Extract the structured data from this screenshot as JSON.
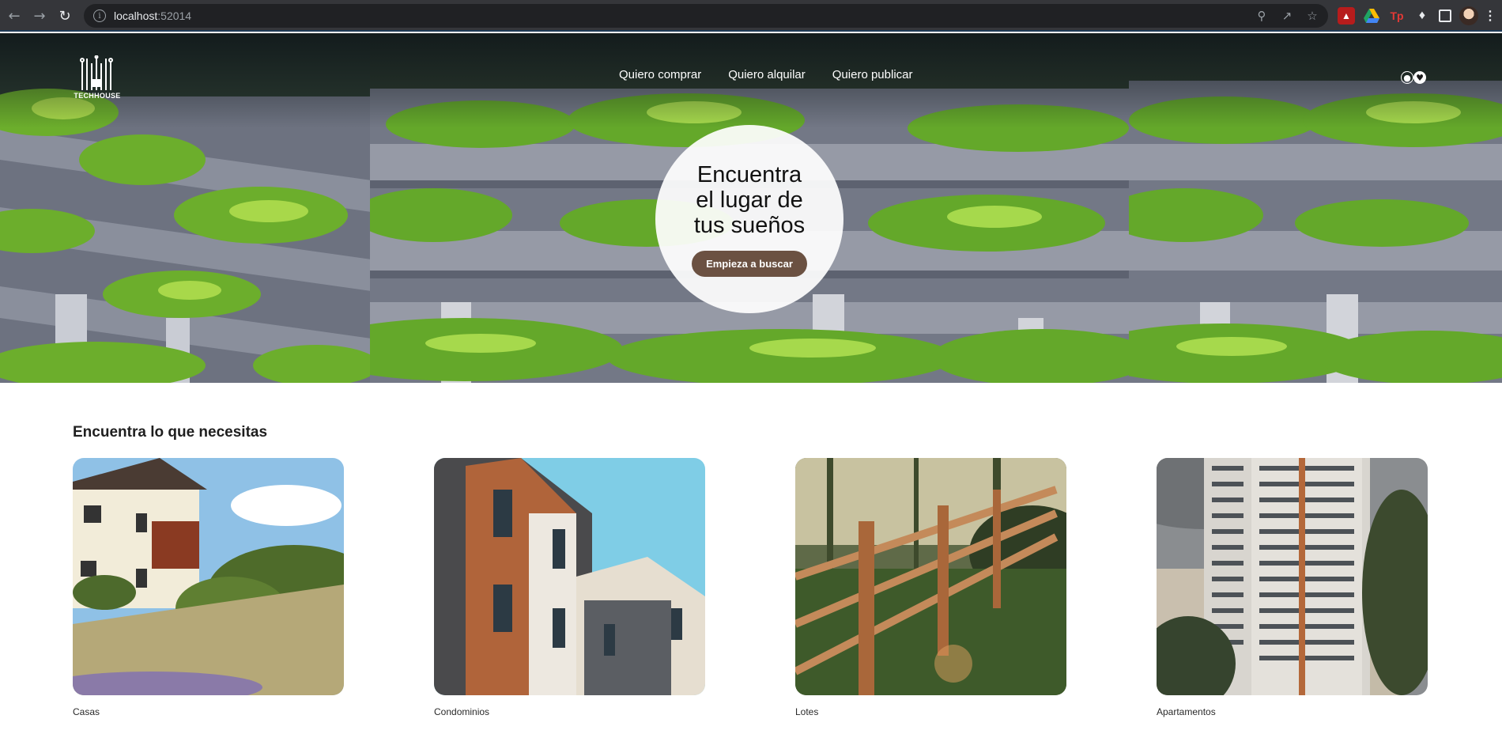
{
  "browser": {
    "url_host": "localhost",
    "url_port": ":52014",
    "icons": [
      "back-icon",
      "forward-icon",
      "reload-icon",
      "info-icon",
      "zoom-icon",
      "share-icon",
      "bookmark-star-icon",
      "pdf-extension-icon",
      "drive-extension-icon",
      "tp-extension-icon",
      "extensions-puzzle-icon",
      "side-panel-icon",
      "profile-avatar",
      "menu-icon"
    ],
    "ext_tp_label": "Tp"
  },
  "header": {
    "logo_text": "TECHHOUSE",
    "nav": [
      {
        "label": "Quiero comprar"
      },
      {
        "label": "Quiero alquilar"
      },
      {
        "label": "Quiero publicar"
      }
    ]
  },
  "hero": {
    "title": "Encuentra el lugar de tus sueños",
    "cta_label": "Empieza a buscar"
  },
  "categories": {
    "title": "Encuentra lo que necesitas",
    "items": [
      {
        "label": "Casas"
      },
      {
        "label": "Condominios"
      },
      {
        "label": "Lotes"
      },
      {
        "label": "Apartamentos"
      }
    ]
  },
  "colors": {
    "cta": "#6b5142",
    "chrome_bg": "#35363a",
    "omnibox_bg": "#202124"
  }
}
